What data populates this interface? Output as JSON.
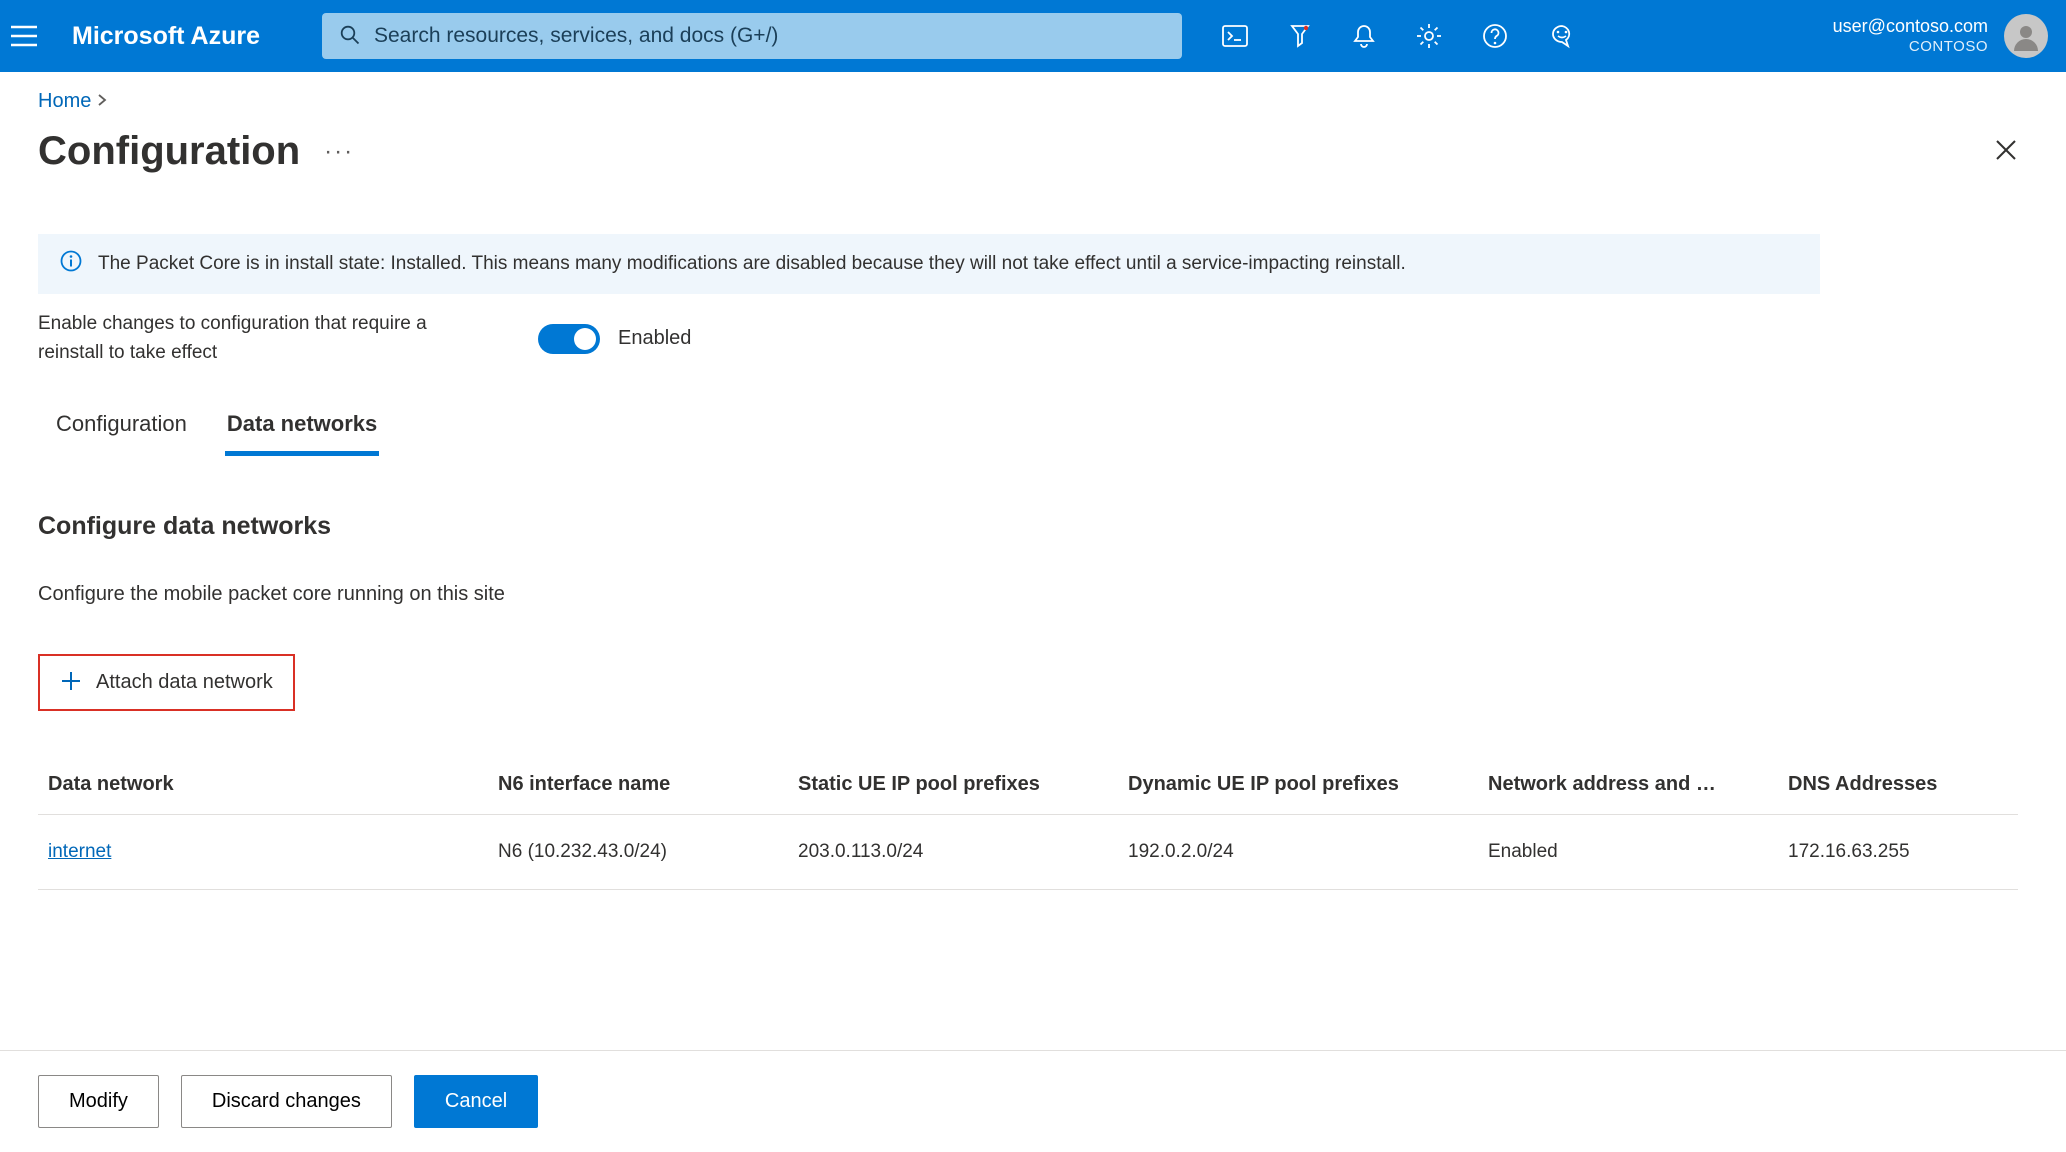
{
  "brand": "Microsoft Azure",
  "search": {
    "placeholder": "Search resources, services, and docs (G+/)"
  },
  "account": {
    "email": "user@contoso.com",
    "tenant": "CONTOSO"
  },
  "breadcrumb": {
    "home": "Home"
  },
  "page": {
    "title": "Configuration"
  },
  "banner": {
    "message": "The Packet Core is in install state: Installed. This means many modifications are disabled because they will not take effect until a service-impacting reinstall."
  },
  "toggle": {
    "description": "Enable changes to configuration that require a reinstall to take effect",
    "state_label": "Enabled"
  },
  "tabs": {
    "configuration": "Configuration",
    "data_networks": "Data networks"
  },
  "section": {
    "heading": "Configure data networks",
    "subheading": "Configure the mobile packet core running on this site"
  },
  "attach_button": "Attach data network",
  "table": {
    "headers": {
      "data_network": "Data network",
      "n6": "N6 interface name",
      "static_prefixes": "Static UE IP pool prefixes",
      "dynamic_prefixes": "Dynamic UE IP pool prefixes",
      "nat": "Network address and …",
      "dns": "DNS Addresses"
    },
    "rows": [
      {
        "data_network": "internet",
        "n6": "N6 (10.232.43.0/24)",
        "static_prefixes": "203.0.113.0/24",
        "dynamic_prefixes": "192.0.2.0/24",
        "nat": "Enabled",
        "dns": "172.16.63.255"
      }
    ]
  },
  "footer": {
    "modify": "Modify",
    "discard": "Discard changes",
    "cancel": "Cancel"
  }
}
